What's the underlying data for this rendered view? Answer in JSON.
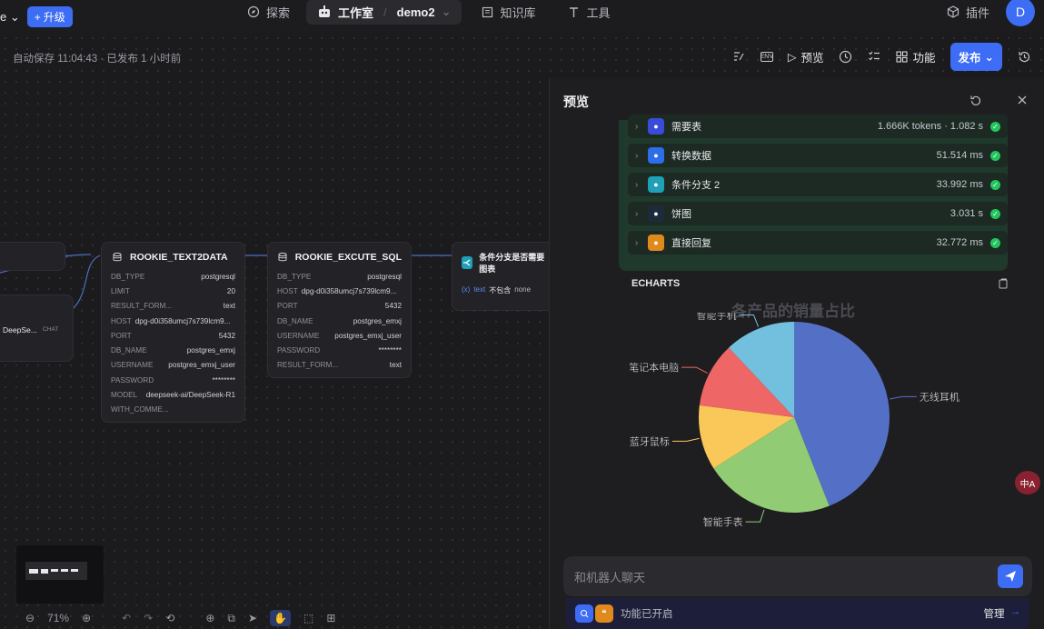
{
  "topbar": {
    "workspace_fragment": "e",
    "upgrade_label": "升级",
    "nav": {
      "explore": "探索",
      "studio": "工作室",
      "app_name": "demo2",
      "knowledge": "知识库",
      "tools": "工具"
    },
    "plugins": "插件",
    "avatar_letter": "D"
  },
  "toolbar2": {
    "autosave_text": "自动保存 11:04:43 · 已发布 1 小时前",
    "env_label": "ENV",
    "preview_label": "预览",
    "features_label": "功能",
    "publish_label": "发布"
  },
  "nodes": {
    "left_stub_label": "DeepSe...",
    "left_stub_tag": "CHAT",
    "text2data": {
      "title": "ROOKIE_TEXT2DATA",
      "rows": [
        {
          "k": "DB_TYPE",
          "v": "postgresql"
        },
        {
          "k": "LIMIT",
          "v": "20"
        },
        {
          "k": "RESULT_FORM...",
          "v": "text"
        },
        {
          "k": "HOST",
          "v": "dpg-d0i358umcj7s739lcm9..."
        },
        {
          "k": "PORT",
          "v": "5432"
        },
        {
          "k": "DB_NAME",
          "v": "postgres_emxj"
        },
        {
          "k": "USERNAME",
          "v": "postgres_emxj_user"
        },
        {
          "k": "PASSWORD",
          "v": "********"
        },
        {
          "k": "MODEL",
          "v": "deepseek-ai/DeepSeek-R1"
        },
        {
          "k": "WITH_COMME...",
          "v": ""
        }
      ]
    },
    "excute_sql": {
      "title": "ROOKIE_EXCUTE_SQL",
      "rows": [
        {
          "k": "DB_TYPE",
          "v": "postgresql"
        },
        {
          "k": "HOST",
          "v": "dpg-d0i358umcj7s739lcm9..."
        },
        {
          "k": "PORT",
          "v": "5432"
        },
        {
          "k": "DB_NAME",
          "v": "postgres_emxj"
        },
        {
          "k": "USERNAME",
          "v": "postgres_emxj_user"
        },
        {
          "k": "PASSWORD",
          "v": "********"
        },
        {
          "k": "RESULT_FORM...",
          "v": "text"
        }
      ]
    },
    "condition": {
      "title": "条件分支是否需要图表",
      "var": "text",
      "op": "不包含",
      "val": "none"
    }
  },
  "preview": {
    "title": "预览",
    "trace": [
      {
        "name": "需要表",
        "time": "1.666K tokens · 1.082 s",
        "color": "#3a4bd8"
      },
      {
        "name": "转换数据",
        "time": "51.514 ms",
        "color": "#2d6ee8"
      },
      {
        "name": "条件分支 2",
        "time": "33.992 ms",
        "color": "#1f9fb8"
      },
      {
        "name": "饼图",
        "time": "3.031 s",
        "color": "#1d2a3a"
      },
      {
        "name": "直接回复",
        "time": "32.772 ms",
        "color": "#e08a1e"
      }
    ],
    "echarts_label": "ECHARTS",
    "chat_placeholder": "和机器人聊天",
    "feature_text": "功能已开启",
    "manage_label": "管理"
  },
  "chart_data": {
    "type": "pie",
    "title": "各产品的销量占比",
    "slices": [
      {
        "name": "无线耳机",
        "value": 44,
        "color": "#5470c6"
      },
      {
        "name": "智能手表",
        "value": 22,
        "color": "#91cc75"
      },
      {
        "name": "蓝牙鼠标",
        "value": 11,
        "color": "#fac858"
      },
      {
        "name": "笔记本电脑",
        "value": 11,
        "color": "#ee6666"
      },
      {
        "name": "智能手机",
        "value": 12,
        "color": "#73c0de"
      }
    ]
  },
  "bottom": {
    "zoom": "71%"
  },
  "translate_badge": "中A"
}
